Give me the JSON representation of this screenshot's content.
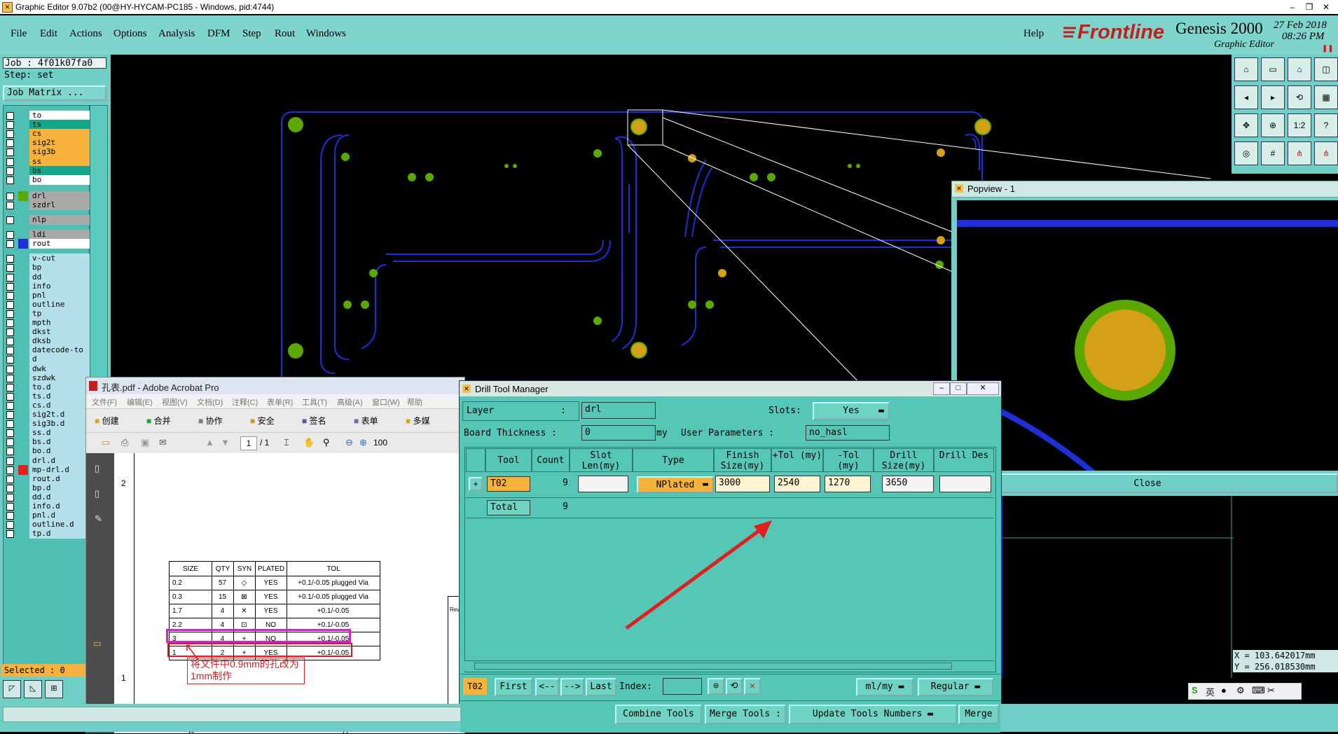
{
  "titlebar": {
    "title": "Graphic Editor 9.07b2 (00@HY-HYCAM-PC185 - Windows, pid:4744)"
  },
  "menubar": {
    "items": [
      "File",
      "Edit",
      "Actions",
      "Options",
      "Analysis",
      "DFM",
      "Step",
      "Rout",
      "Windows"
    ],
    "help": "Help"
  },
  "brand": {
    "logo": "Frontline",
    "product": "Genesis 2000",
    "subtitle": "Graphic Editor",
    "date": "27 Feb 2018",
    "time": "08:26 PM"
  },
  "job": {
    "job_label": "Job : 4f01k07fa0",
    "step_label": "Step: set",
    "matrix_button": "Job Matrix ..."
  },
  "layers": [
    {
      "name": "to",
      "color": "#ffffff"
    },
    {
      "name": "ts",
      "color": "#12a68a"
    },
    {
      "name": "cs",
      "color": "#f7b23b"
    },
    {
      "name": "sig2t",
      "color": "#f7b23b"
    },
    {
      "name": "sig3b",
      "color": "#f7b23b"
    },
    {
      "name": "ss",
      "color": "#f7b23b"
    },
    {
      "name": "bs",
      "color": "#12a68a"
    },
    {
      "name": "bo",
      "color": "#ffffff"
    },
    {
      "name": "drl",
      "color": "#a9a9a9"
    },
    {
      "name": "szdrl",
      "color": "#a9a9a9"
    },
    {
      "name": "nlp",
      "color": "#a9a9a9"
    },
    {
      "name": "ldi",
      "color": "#a9a9a9"
    },
    {
      "name": "rout",
      "color": "#ffffff"
    },
    {
      "name": "v-cut",
      "color": "#b3e0ea"
    },
    {
      "name": "bp",
      "color": "#b3e0ea"
    },
    {
      "name": "dd",
      "color": "#b3e0ea"
    },
    {
      "name": "info",
      "color": "#b3e0ea"
    },
    {
      "name": "pnl",
      "color": "#b3e0ea"
    },
    {
      "name": "outline",
      "color": "#b3e0ea"
    },
    {
      "name": "tp",
      "color": "#b3e0ea"
    },
    {
      "name": "mpth",
      "color": "#b3e0ea"
    },
    {
      "name": "dkst",
      "color": "#b3e0ea"
    },
    {
      "name": "dksb",
      "color": "#b3e0ea"
    },
    {
      "name": "datecode-to",
      "color": "#b3e0ea"
    },
    {
      "name": "d",
      "color": "#b3e0ea"
    },
    {
      "name": "dwk",
      "color": "#b3e0ea"
    },
    {
      "name": "szdwk",
      "color": "#b3e0ea"
    },
    {
      "name": "to.d",
      "color": "#b3e0ea"
    },
    {
      "name": "ts.d",
      "color": "#b3e0ea"
    },
    {
      "name": "cs.d",
      "color": "#b3e0ea"
    },
    {
      "name": "sig2t.d",
      "color": "#b3e0ea"
    },
    {
      "name": "sig3b.d",
      "color": "#b3e0ea"
    },
    {
      "name": "ss.d",
      "color": "#b3e0ea"
    },
    {
      "name": "bs.d",
      "color": "#b3e0ea"
    },
    {
      "name": "bo.d",
      "color": "#b3e0ea"
    },
    {
      "name": "drl.d",
      "color": "#b3e0ea"
    },
    {
      "name": "mp-drl.d",
      "color": "#b3e0ea"
    },
    {
      "name": "rout.d",
      "color": "#b3e0ea"
    },
    {
      "name": "bp.d",
      "color": "#b3e0ea"
    },
    {
      "name": "dd.d",
      "color": "#b3e0ea"
    },
    {
      "name": "info.d",
      "color": "#b3e0ea"
    },
    {
      "name": "pnl.d",
      "color": "#b3e0ea"
    },
    {
      "name": "outline.d",
      "color": "#b3e0ea"
    },
    {
      "name": "tp.d",
      "color": "#b3e0ea"
    }
  ],
  "selected": "Selected : 0",
  "popview": {
    "title": "Popview - 1",
    "close": "Close",
    "coord_x": "X = 103.642017mm",
    "coord_y": "Y = 256.018530mm"
  },
  "acrobat": {
    "title": "孔表.pdf - Adobe Acrobat Pro",
    "menu": [
      "文件(F)",
      "编辑(E)",
      "视图(V)",
      "文档(D)",
      "注释(C)",
      "表单(R)",
      "工具(T)",
      "高级(A)",
      "窗口(W)",
      "帮助"
    ],
    "toolbar": [
      "创建",
      "合并",
      "协作",
      "安全",
      "签名",
      "表单",
      "多媒"
    ],
    "page": "1",
    "page_total": "/ 1",
    "zoom": "100",
    "row_labels": [
      "2",
      "1"
    ],
    "col_labels": [
      "A",
      "B"
    ],
    "table_headers": [
      "SIZE",
      "QTY",
      "SYN",
      "PLATED",
      "TOL"
    ],
    "table_rows": [
      [
        "0.2",
        "57",
        "YES",
        "+0.1/-0.05 plugged Via"
      ],
      [
        "0.3",
        "15",
        "YES",
        "+0.1/-0.05 plugged Via"
      ],
      [
        "1.7",
        "4",
        "YES",
        "+0.1/-0.05"
      ],
      [
        "2.2",
        "4",
        "NO",
        "+0.1/-0.05"
      ],
      [
        "3",
        "4",
        "NO",
        "+0.1/-0.05"
      ],
      [
        "1",
        "2",
        "YES",
        "+0.1/-0.05"
      ]
    ],
    "annotation": "将文件中0.9mm的孔改为1mm制作",
    "rev_label": "Rev"
  },
  "dtm": {
    "title": "Drill Tool Manager",
    "layer_label": "Layer",
    "layer_value": "drl",
    "slots_label": "Slots:",
    "slots_value": "Yes",
    "board_thickness_label": "Board Thickness :",
    "board_thickness_value": "0",
    "board_thickness_unit": "my",
    "user_params_label": "User Parameters :",
    "user_params_value": "no_hasl",
    "headers": [
      "Tool",
      "Count",
      "Slot Len(my)",
      "Type",
      "Finish Size(my)",
      "+Tol (my)",
      "-Tol (my)",
      "Drill Size(my)",
      "Drill Des"
    ],
    "row": {
      "tool": "T02",
      "count": "9",
      "slot_len": "",
      "type": "NPlated",
      "finish": "3000",
      "ptol": "2540",
      "ntol": "1270",
      "drill": "3650",
      "des": ""
    },
    "total_label": "Total",
    "total_count": "9",
    "nav": {
      "current": "T02",
      "first": "First",
      "prev": "<--",
      "next": "-->",
      "last": "Last",
      "index_label": "Index:",
      "units": "ml/my",
      "mode": "Regular"
    },
    "bottom": {
      "combine": "Combine Tools",
      "merge_tools": "Merge Tools :",
      "update": "Update Tools Numbers",
      "merge": "Merge"
    }
  },
  "colors": {
    "panel": "#6fcfc6",
    "dialog": "#56c7b6",
    "pad_yellow": "#d4a017",
    "pad_green": "#5aa800",
    "rout_blue": "#1f2fd6",
    "arrow_red": "#e02020"
  },
  "ime": {
    "label": "英"
  }
}
